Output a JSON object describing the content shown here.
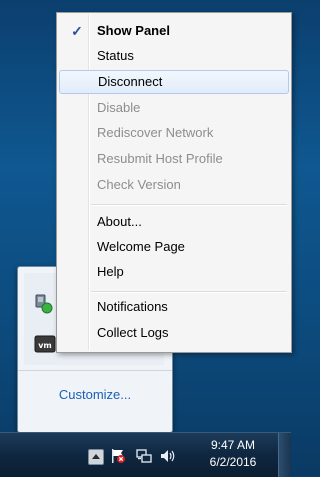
{
  "menu": {
    "items": [
      {
        "label": "Show Panel",
        "checked": true,
        "bold": true,
        "disabled": false
      },
      {
        "label": "Status",
        "disabled": false
      },
      {
        "label": "Disconnect",
        "disabled": false,
        "highlighted": true
      },
      {
        "label": "Disable",
        "disabled": true
      },
      {
        "label": "Rediscover Network",
        "disabled": true
      },
      {
        "label": "Resubmit Host Profile",
        "disabled": true
      },
      {
        "label": "Check Version",
        "disabled": true
      },
      {
        "label": "About...",
        "disabled": false
      },
      {
        "label": "Welcome Page",
        "disabled": false
      },
      {
        "label": "Help",
        "disabled": false
      },
      {
        "label": "Notifications",
        "disabled": false
      },
      {
        "label": "Collect Logs",
        "disabled": false
      }
    ],
    "check_glyph": "✓"
  },
  "tray_popup": {
    "customize_label": "Customize...",
    "icons": [
      "network-agent-icon",
      "vm-icon"
    ]
  },
  "taskbar": {
    "time": "9:47 AM",
    "date": "6/2/2016",
    "icons": [
      "show-hidden-icons-arrow",
      "action-center-flag-icon",
      "network-icon",
      "volume-icon"
    ]
  },
  "colors": {
    "desktop": "#0f5891",
    "menu_highlight": "#e1ecfa",
    "disabled_text": "#8d8d8d",
    "link": "#1a5fb4"
  }
}
